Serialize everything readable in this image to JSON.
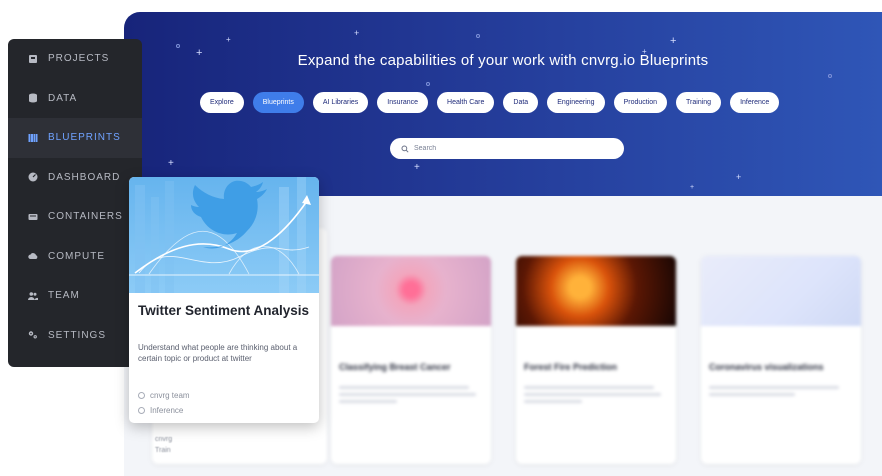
{
  "hero": {
    "title": "Expand the capabilities of your work with cnvrg.io Blueprints",
    "chips": [
      {
        "label": "Explore",
        "active": false
      },
      {
        "label": "Blueprints",
        "active": true
      },
      {
        "label": "AI Libraries",
        "active": false
      },
      {
        "label": "Insurance",
        "active": false
      },
      {
        "label": "Health Care",
        "active": false
      },
      {
        "label": "Data",
        "active": false
      },
      {
        "label": "Engineering",
        "active": false
      },
      {
        "label": "Production",
        "active": false
      },
      {
        "label": "Training",
        "active": false
      },
      {
        "label": "Inference",
        "active": false
      }
    ],
    "search_placeholder": "Search"
  },
  "sidebar": {
    "items": [
      {
        "label": "PROJECTS",
        "icon": "projects-icon",
        "active": false
      },
      {
        "label": "DATA",
        "icon": "data-icon",
        "active": false
      },
      {
        "label": "BLUEPRINTS",
        "icon": "blueprints-icon",
        "active": true
      },
      {
        "label": "DASHBOARD",
        "icon": "dashboard-icon",
        "active": false
      },
      {
        "label": "CONTAINERS",
        "icon": "containers-icon",
        "active": false
      },
      {
        "label": "COMPUTE",
        "icon": "compute-icon",
        "active": false
      },
      {
        "label": "TEAM",
        "icon": "team-icon",
        "active": false
      },
      {
        "label": "SETTINGS",
        "icon": "settings-icon",
        "active": false
      }
    ]
  },
  "featured_card": {
    "title": "Twitter Sentiment Analysis",
    "description": "Understand what people are thinking about a certain topic or product at twitter",
    "author": "cnvrg team",
    "tag": "Inference",
    "image_icon": "twitter-bird-icon"
  },
  "cards": [
    {
      "title": "Classifying Breast Cancer"
    },
    {
      "title": "Forest Fire Prediction"
    },
    {
      "title": "Coronavirus visualizations"
    }
  ],
  "partial_card": {
    "author": "cnvrg",
    "tag": "Train"
  },
  "colors": {
    "hero_start": "#17247a",
    "hero_end": "#2f56b7",
    "accent": "#3f7dea",
    "sidebar_bg": "#24262b",
    "sidebar_active": "#6fa2ff"
  }
}
